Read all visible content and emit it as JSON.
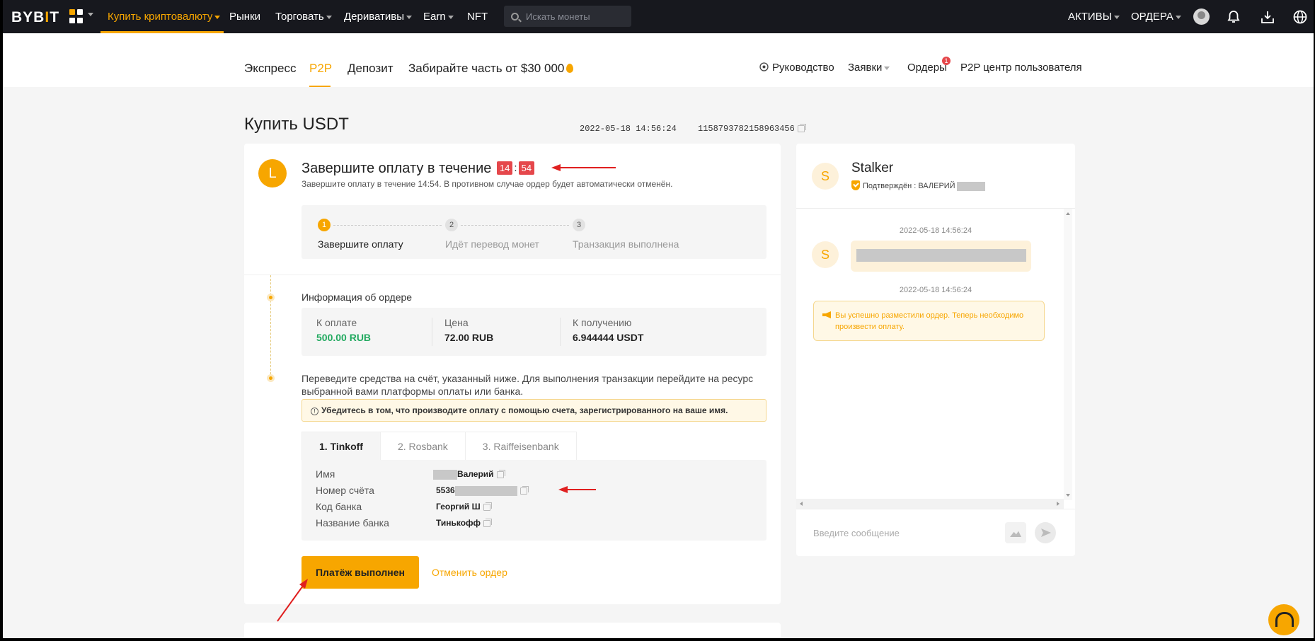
{
  "topnav": {
    "logo": "BYBIT",
    "items": [
      {
        "label": "Купить криптовалюту",
        "active": true,
        "dropdown": true
      },
      {
        "label": "Рынки",
        "dropdown": false
      },
      {
        "label": "Торговать",
        "dropdown": true
      },
      {
        "label": "Деривативы",
        "dropdown": true
      },
      {
        "label": "Earn",
        "dropdown": true
      },
      {
        "label": "NFT",
        "dropdown": false
      }
    ],
    "search_placeholder": "Искать монеты",
    "assets_label": "АКТИВЫ",
    "orders_label": "ОРДЕРА",
    "icons": [
      "avatar",
      "bell-icon",
      "download-icon",
      "globe-icon"
    ]
  },
  "subnav": {
    "tabs": [
      "Экспресс",
      "P2P",
      "Депозит",
      "Забирайте часть от $30 000"
    ],
    "active_tab": "P2P",
    "guide": "Руководство",
    "requests": "Заявки",
    "orders": "Ордеры",
    "orders_badge": "1",
    "user_center": "P2P центр пользователя"
  },
  "page": {
    "title": "Купить USDT",
    "datetime": "2022-05-18 14:56:24",
    "order_id": "1158793782158963456"
  },
  "payment": {
    "avatar_letter": "L",
    "title": "Завершите оплату в течение",
    "timer_min": "14",
    "timer_sep": ":",
    "timer_sec": "54",
    "subtitle": "Завершите оплату в течение 14:54. В противном случае ордер будет автоматически отменён.",
    "steps": [
      {
        "num": "1",
        "label": "Завершите оплату",
        "active": true
      },
      {
        "num": "2",
        "label": "Идёт перевод монет",
        "active": false
      },
      {
        "num": "3",
        "label": "Транзакция выполнена",
        "active": false
      }
    ]
  },
  "order_info": {
    "heading": "Информация об ордере",
    "pay_label": "К оплате",
    "pay_value": "500.00 RUB",
    "price_label": "Цена",
    "price_value": "72.00 RUB",
    "receive_label": "К получению",
    "receive_value": "6.944444 USDT"
  },
  "transfer": {
    "text": "Переведите средства на счёт, указанный ниже. Для выполнения транзакции перейдите на ресурс выбранной вами платформы оплаты или банка.",
    "warning": "Убедитесь в том, что производите оплату с помощью счета, зарегистрированного на ваше имя.",
    "bank_tabs": [
      "1. Tinkoff",
      "2. Rosbank",
      "3. Raiffeisenbank"
    ],
    "active_bank": "1. Tinkoff",
    "details": {
      "name_label": "Имя",
      "name_value": "Валерий",
      "account_label": "Номер счёта",
      "account_value": "5536",
      "bank_code_label": "Код банка",
      "bank_code_value": "Георгий Ш",
      "bank_name_label": "Название банка",
      "bank_name_value": "Тинькофф"
    }
  },
  "actions": {
    "paid_button": "Платёж выполнен",
    "cancel_link": "Отменить ордер"
  },
  "chat": {
    "seller_letter": "S",
    "seller_name": "Stalker",
    "verified_label": "Подтверждён : ВАЛЕРИЙ",
    "messages": [
      {
        "time": "2022-05-18 14:56:24"
      },
      {
        "time": "2022-05-18 14:56:24",
        "system_text": "Вы успешно разместили ордер. Теперь необходимо произвести оплату."
      }
    ],
    "input_placeholder": "Введите  сообщение"
  },
  "colors": {
    "accent": "#f7a600",
    "danger": "#e5474b",
    "success": "#21a95f",
    "nav_bg": "#17181e"
  }
}
